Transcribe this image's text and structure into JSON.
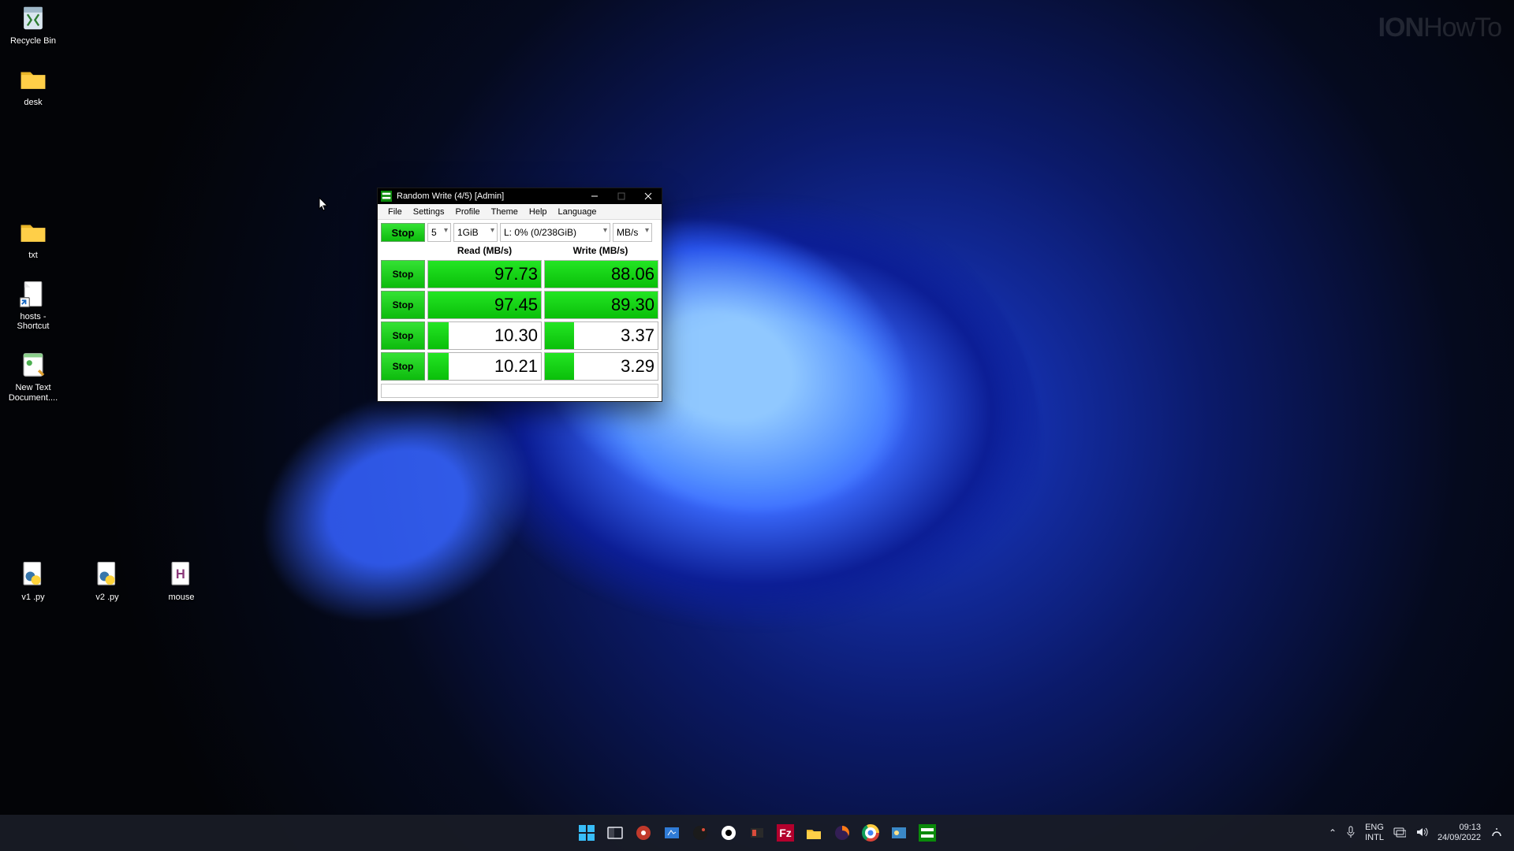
{
  "watermark": "IONHowTo",
  "watermark_thin": "HowTo",
  "watermark_bold": "ION",
  "desktop_icons_left": [
    {
      "name": "Recycle Bin"
    },
    {
      "name": "desk"
    },
    {
      "name": "txt"
    },
    {
      "name": "hosts - Shortcut"
    },
    {
      "name": "New Text Document...."
    }
  ],
  "desktop_icons_bottom": [
    {
      "name": "v1 .py"
    },
    {
      "name": "v2 .py"
    },
    {
      "name": "mouse"
    }
  ],
  "window": {
    "title": "Random Write (4/5) [Admin]",
    "menu": [
      "File",
      "Settings",
      "Profile",
      "Theme",
      "Help",
      "Language"
    ],
    "stop_all": "Stop",
    "count": "5",
    "size": "1GiB",
    "drive": "L: 0% (0/238GiB)",
    "unit": "MB/s",
    "read_header": "Read (MB/s)",
    "write_header": "Write (MB/s)",
    "rows": [
      {
        "btn": "Stop",
        "read": "97.73",
        "read_pct": 100,
        "write": "88.06",
        "write_pct": 100
      },
      {
        "btn": "Stop",
        "read": "97.45",
        "read_pct": 100,
        "write": "89.30",
        "write_pct": 100
      },
      {
        "btn": "Stop",
        "read": "10.30",
        "read_pct": 18,
        "write": "3.37",
        "write_pct": 26
      },
      {
        "btn": "Stop",
        "read": "10.21",
        "read_pct": 18,
        "write": "3.29",
        "write_pct": 26
      }
    ]
  },
  "taskbar": {
    "lang1": "ENG",
    "lang2": "INTL",
    "time": "09:13",
    "date": "24/09/2022"
  }
}
